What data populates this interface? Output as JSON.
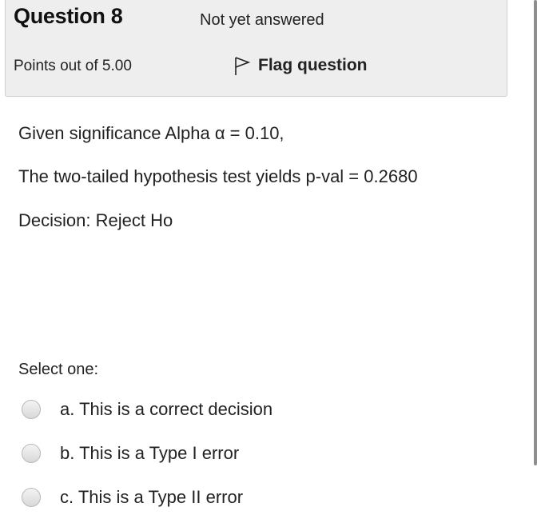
{
  "question": {
    "title": "Question 8",
    "status": "Not yet answered",
    "points": "Points out of 5.00",
    "flag_label": "Flag question"
  },
  "question_text": {
    "line1": "Given significance Alpha α = 0.10,",
    "line2": "The two-tailed hypothesis test yields p-val = 0.2680",
    "line3": "Decision:  Reject Ho"
  },
  "answer": {
    "prompt": "Select one:",
    "options": [
      {
        "label": "a. This is a correct decision",
        "selected": false
      },
      {
        "label": "b. This is a Type I error",
        "selected": false
      },
      {
        "label": "c. This is a Type II error",
        "selected": false
      }
    ]
  },
  "icons": {
    "flag": "flag-icon"
  },
  "colors": {
    "info_background": "#eeeeee",
    "text": "#222222"
  }
}
